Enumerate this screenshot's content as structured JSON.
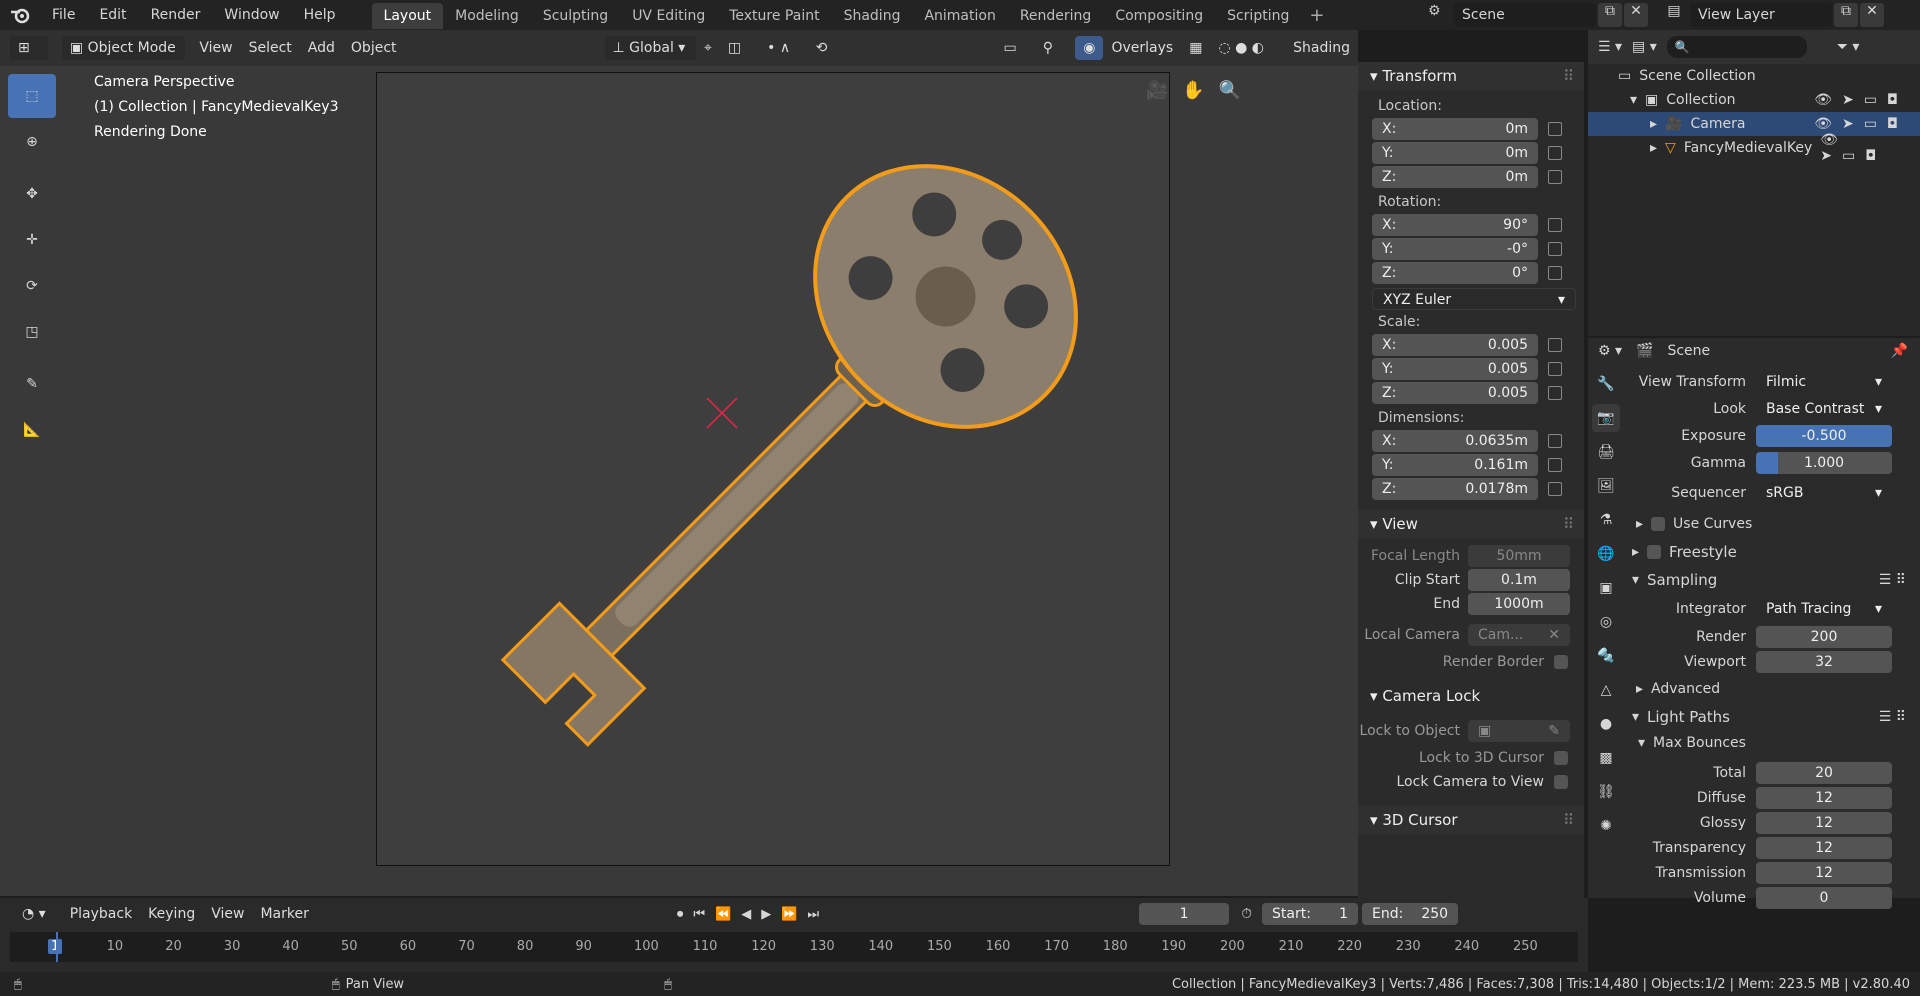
{
  "top_menu": [
    "File",
    "Edit",
    "Render",
    "Window",
    "Help"
  ],
  "workspaces": [
    "Layout",
    "Modeling",
    "Sculpting",
    "UV Editing",
    "Texture Paint",
    "Shading",
    "Animation",
    "Rendering",
    "Compositing",
    "Scripting"
  ],
  "active_workspace": "Layout",
  "scene_name": "Scene",
  "view_layer_name": "View Layer",
  "header": {
    "mode": "Object Mode",
    "menus": [
      "View",
      "Select",
      "Add",
      "Object"
    ],
    "orientation": "Global",
    "overlays": "Overlays",
    "shading": "Shading"
  },
  "viewport_info": {
    "line1": "Camera Perspective",
    "line2": "(1) Collection | FancyMedievalKey3",
    "line3": "Rendering Done"
  },
  "transform": {
    "title": "Transform",
    "location_label": "Location:",
    "location": [
      {
        "axis": "X:",
        "value": "0m"
      },
      {
        "axis": "Y:",
        "value": "0m"
      },
      {
        "axis": "Z:",
        "value": "0m"
      }
    ],
    "rotation_label": "Rotation:",
    "rotation": [
      {
        "axis": "X:",
        "value": "90°"
      },
      {
        "axis": "Y:",
        "value": "-0°"
      },
      {
        "axis": "Z:",
        "value": "0°"
      }
    ],
    "rotation_mode": "XYZ Euler",
    "scale_label": "Scale:",
    "scale": [
      {
        "axis": "X:",
        "value": "0.005"
      },
      {
        "axis": "Y:",
        "value": "0.005"
      },
      {
        "axis": "Z:",
        "value": "0.005"
      }
    ],
    "dimensions_label": "Dimensions:",
    "dimensions": [
      {
        "axis": "X:",
        "value": "0.0635m"
      },
      {
        "axis": "Y:",
        "value": "0.161m"
      },
      {
        "axis": "Z:",
        "value": "0.0178m"
      }
    ]
  },
  "view_panel": {
    "title": "View",
    "focal_length_label": "Focal Length",
    "focal_length": "50mm",
    "clip_start_label": "Clip Start",
    "clip_start": "0.1m",
    "clip_end_label": "End",
    "clip_end": "1000m",
    "local_camera_label": "Local Camera",
    "local_camera": "Cam...",
    "render_border_label": "Render Border"
  },
  "camera_lock": {
    "title": "Camera Lock",
    "lock_to_object_label": "Lock to Object",
    "lock_to_3d_cursor_label": "Lock to 3D Cursor",
    "lock_camera_to_view_label": "Lock Camera to View"
  },
  "cursor_panel_title": "3D Cursor",
  "outliner": {
    "root": "Scene Collection",
    "collection": "Collection",
    "items": [
      "Camera",
      "FancyMedievalKey"
    ]
  },
  "properties": {
    "context": "Scene",
    "view_transform_label": "View Transform",
    "view_transform": "Filmic",
    "look_label": "Look",
    "look": "Base Contrast",
    "exposure_label": "Exposure",
    "exposure": "-0.500",
    "gamma_label": "Gamma",
    "gamma": "1.000",
    "sequencer_label": "Sequencer",
    "sequencer": "sRGB",
    "use_curves": "Use Curves",
    "freestyle": "Freestyle",
    "sampling": "Sampling",
    "integrator_label": "Integrator",
    "integrator": "Path Tracing",
    "render_label": "Render",
    "render": "200",
    "viewport_label": "Viewport",
    "viewport": "32",
    "advanced": "Advanced",
    "light_paths": "Light Paths",
    "max_bounces": "Max Bounces",
    "bounces": [
      {
        "label": "Total",
        "value": "20"
      },
      {
        "label": "Diffuse",
        "value": "12"
      },
      {
        "label": "Glossy",
        "value": "12"
      },
      {
        "label": "Transparency",
        "value": "12"
      },
      {
        "label": "Transmission",
        "value": "12"
      },
      {
        "label": "Volume",
        "value": "0"
      }
    ]
  },
  "timeline": {
    "menus": [
      "Playback",
      "Keying",
      "View",
      "Marker"
    ],
    "current_frame": "1",
    "start_label": "Start:",
    "start": "1",
    "end_label": "End:",
    "end": "250",
    "ruler": [
      "1",
      "10",
      "20",
      "30",
      "40",
      "50",
      "60",
      "70",
      "80",
      "90",
      "100",
      "110",
      "120",
      "130",
      "140",
      "150",
      "160",
      "170",
      "180",
      "190",
      "200",
      "210",
      "220",
      "230",
      "240",
      "250"
    ]
  },
  "status": {
    "left": "Pan View",
    "right": "Collection | FancyMedievalKey3 | Verts:7,486 | Faces:7,308 | Tris:14,480 | Objects:1/2 | Mem: 223.5 MB | v2.80.40"
  }
}
